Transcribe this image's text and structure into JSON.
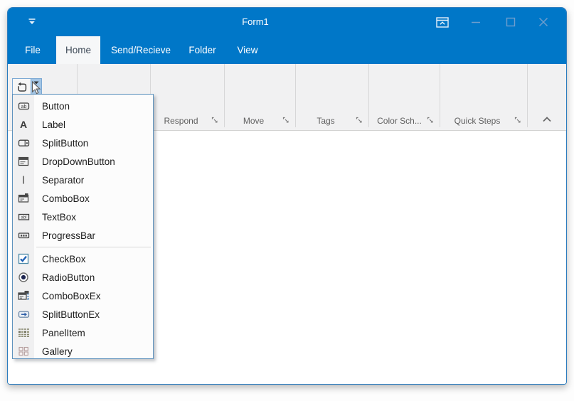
{
  "colors": {
    "titlebar_blue": "#0077c8",
    "ribbon_background": "#f1f1f2",
    "selected_tab_background": "#f6f7f8",
    "menu_border": "#5f93be",
    "dropdown_highlight_fill": "#a3c5e5",
    "dropdown_highlight_border": "#7ca9d4",
    "group_label_text": "#5f5f5f",
    "checkbox_check_blue": "#1d5fb4"
  },
  "titlebar": {
    "title": "Form1",
    "icons": {
      "quick_access": "customize-quick-access-toolbar-icon",
      "ribbon_display": "ribbon-display-options-icon",
      "minimize": "minimize-icon",
      "maximize": "maximize-icon",
      "close": "close-icon"
    }
  },
  "tabs": [
    {
      "label": "File",
      "selected": false
    },
    {
      "label": "Home",
      "selected": true
    },
    {
      "label": "Send/Recieve",
      "selected": false
    },
    {
      "label": "Folder",
      "selected": false
    },
    {
      "label": "View",
      "selected": false
    }
  ],
  "ribbon": {
    "tool_button_icon": "rotate-icon",
    "groups": [
      {
        "label": "Respond",
        "launcher_icon": "dialog-launcher-icon"
      },
      {
        "label": "Move",
        "launcher_icon": "dialog-launcher-icon"
      },
      {
        "label": "Tags",
        "launcher_icon": "dialog-launcher-icon"
      },
      {
        "label": "Color Sch...",
        "launcher_icon": "dialog-launcher-icon"
      },
      {
        "label": "Quick Steps",
        "launcher_icon": "dialog-launcher-icon"
      }
    ],
    "collapse_icon": "chevron-up-icon"
  },
  "menu": {
    "separator_after_index": 7,
    "items": [
      {
        "label": "Button",
        "icon": "button-icon"
      },
      {
        "label": "Label",
        "icon": "label-icon"
      },
      {
        "label": "SplitButton",
        "icon": "splitbutton-icon"
      },
      {
        "label": "DropDownButton",
        "icon": "dropdownbutton-icon"
      },
      {
        "label": "Separator",
        "icon": "separator-icon"
      },
      {
        "label": "ComboBox",
        "icon": "combobox-icon"
      },
      {
        "label": "TextBox",
        "icon": "textbox-icon"
      },
      {
        "label": "ProgressBar",
        "icon": "progressbar-icon"
      },
      {
        "label": "CheckBox",
        "icon": "checkbox-icon"
      },
      {
        "label": "RadioButton",
        "icon": "radiobutton-icon"
      },
      {
        "label": "ComboBoxEx",
        "icon": "comboboxex-icon"
      },
      {
        "label": "SplitButtonEx",
        "icon": "splitbuttonex-icon"
      },
      {
        "label": "PanelItem",
        "icon": "panelitem-icon"
      },
      {
        "label": "Gallery",
        "icon": "gallery-icon"
      }
    ]
  }
}
